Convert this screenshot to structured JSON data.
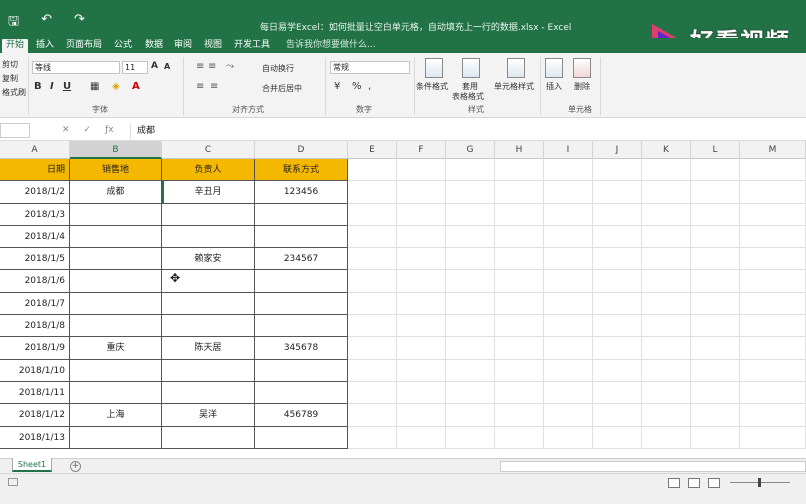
{
  "titlebar": {
    "title": "每日易学Excel：如何批量让空白单元格，自动填充上一行的数据.xlsx - Excel",
    "qat_icons": [
      "save-icon",
      "undo-icon",
      "redo-icon"
    ]
  },
  "watermark": {
    "text": "好看视频"
  },
  "menu": {
    "tabs": [
      "开始",
      "插入",
      "页面布局",
      "公式",
      "数据",
      "审阅",
      "视图",
      "开发工具"
    ],
    "tellme": "告诉我你想要做什么..."
  },
  "ribbon": {
    "clipboard": [
      "剪切",
      "复制",
      "格式刷"
    ],
    "font_name": "等线",
    "font_size": "11",
    "font_group": "字体",
    "wrap_text": "自动换行",
    "merge_center": "合并后居中",
    "align_group": "对齐方式",
    "number_format": "常规",
    "number_group": "数字",
    "cond_format": "条件格式",
    "table_format_1": "套用",
    "table_format_2": "表格格式",
    "cell_styles": "单元格样式",
    "styles_group": "样式",
    "insert": "插入",
    "delete": "删除",
    "cells_group": "单元格"
  },
  "formula_bar": {
    "content": "成都"
  },
  "grid": {
    "columns": [
      "A",
      "B",
      "C",
      "D",
      "E",
      "F",
      "G",
      "H",
      "I",
      "J",
      "K",
      "L",
      "M"
    ],
    "selected_column": "B",
    "header": [
      "日期",
      "销售地",
      "负责人",
      "联系方式"
    ],
    "rows": [
      [
        "2018/1/2",
        "成都",
        "辛丑月",
        "123456"
      ],
      [
        "2018/1/3",
        "",
        "",
        ""
      ],
      [
        "2018/1/4",
        "",
        "",
        ""
      ],
      [
        "2018/1/5",
        "",
        "赖家安",
        "234567"
      ],
      [
        "2018/1/6",
        "",
        "",
        ""
      ],
      [
        "2018/1/7",
        "",
        "",
        ""
      ],
      [
        "2018/1/8",
        "",
        "",
        ""
      ],
      [
        "2018/1/9",
        "重庆",
        "陈天居",
        "345678"
      ],
      [
        "2018/1/10",
        "",
        "",
        ""
      ],
      [
        "2018/1/11",
        "",
        "",
        ""
      ],
      [
        "2018/1/12",
        "上海",
        "吴洋",
        "456789"
      ],
      [
        "2018/1/13",
        "",
        "",
        ""
      ]
    ]
  },
  "sheet_tabs": [
    "Sheet1"
  ],
  "colors": {
    "excel_green": "#217346",
    "header_fill": "#f5b800"
  }
}
